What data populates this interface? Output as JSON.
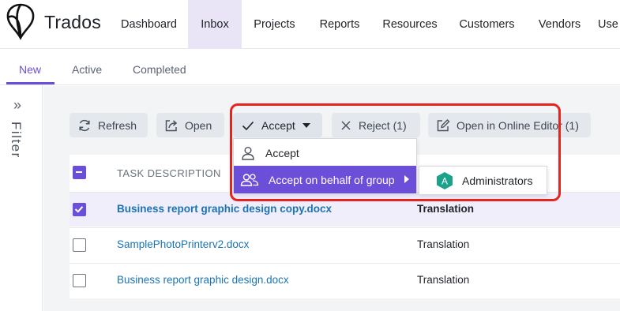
{
  "brand": {
    "name": "Trados"
  },
  "nav": {
    "items": [
      {
        "label": "Dashboard"
      },
      {
        "label": "Inbox"
      },
      {
        "label": "Projects"
      },
      {
        "label": "Reports"
      },
      {
        "label": "Resources"
      },
      {
        "label": "Customers"
      },
      {
        "label": "Vendors"
      },
      {
        "label": "Use"
      }
    ],
    "active": "Inbox"
  },
  "subtabs": {
    "items": [
      {
        "label": "New"
      },
      {
        "label": "Active"
      },
      {
        "label": "Completed"
      }
    ],
    "active": "New"
  },
  "filter": {
    "label": "Filter",
    "icon": "double-chevron-right-icon"
  },
  "toolbar": {
    "refresh": "Refresh",
    "open": "Open",
    "accept": "Accept",
    "reject": "Reject (1)",
    "open_online": "Open in Online Editor (1)"
  },
  "accept_menu": {
    "items": [
      {
        "label": "Accept",
        "icon": "user-icon"
      },
      {
        "label": "Accept on behalf of group",
        "icon": "group-icon"
      }
    ],
    "submenu": {
      "badge": "A",
      "label": "Administrators"
    }
  },
  "table": {
    "header": "TASK DESCRIPTION",
    "rows": [
      {
        "name": "Business report graphic design copy.docx",
        "type": "Translation",
        "checked": true
      },
      {
        "name": "SamplePhotoPrinterv2.docx",
        "type": "Translation",
        "checked": false
      },
      {
        "name": "Business report graphic design.docx",
        "type": "Translation",
        "checked": false
      }
    ]
  },
  "colors": {
    "accent": "#6b4fd8",
    "link": "#1b73b3",
    "highlight": "#e8231f",
    "badge": "#1aa38a"
  }
}
